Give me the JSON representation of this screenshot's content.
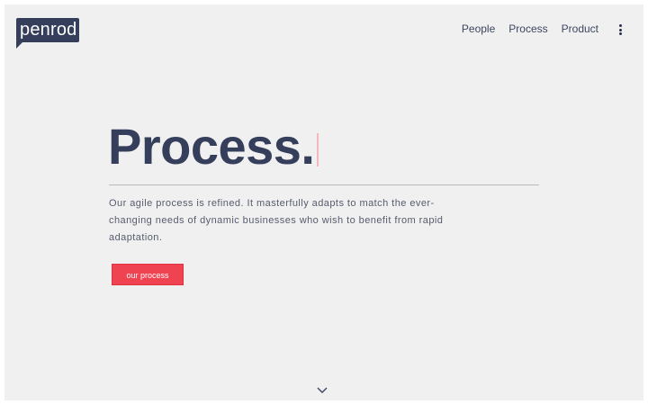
{
  "header": {
    "logo_text": "penrod",
    "nav": [
      "People",
      "Process",
      "Product"
    ],
    "menu_icon": "kebab-menu-icon"
  },
  "hero": {
    "title": "Process.",
    "description": "Our agile process is refined. It masterfully adapts to match the ever-changing needs of dynamic businesses who wish to benefit from rapid adaptation.",
    "cta_label": "our process",
    "scroll_icon": "chevron-down-icon"
  },
  "colors": {
    "background": "#f0f0f1",
    "brand_navy": "#353f5b",
    "accent_red": "#f04351",
    "cursor_pink": "#f2b9bd"
  }
}
